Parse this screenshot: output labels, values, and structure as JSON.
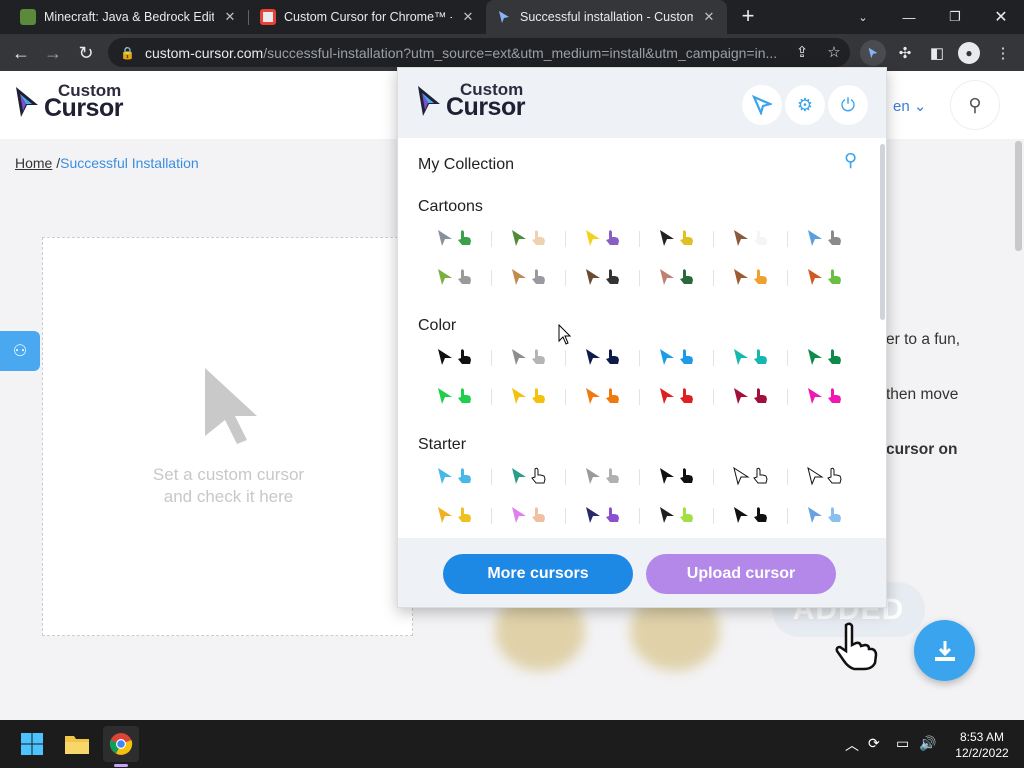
{
  "browser": {
    "tabs": [
      {
        "title": "Minecraft: Java & Bedrock Edition f",
        "active": false
      },
      {
        "title": "Custom Cursor for Chrome™ - Chr",
        "active": false
      },
      {
        "title": "Successful installation - Custom C",
        "active": true
      }
    ],
    "url_host": "custom-cursor.com",
    "url_path": "/successful-installation?utm_source=ext&utm_medium=install&utm_campaign=in..."
  },
  "site": {
    "logo_top": "Custom",
    "logo_bottom": "Cursor",
    "language": "en",
    "breadcrumb_home": "Home",
    "breadcrumb_sep": "/",
    "breadcrumb_current": "Successful Installation",
    "test_hint_line1": "Set a custom cursor",
    "test_hint_line2": "and check it here",
    "body_line1": "er to a fun,",
    "body_line2": "then move",
    "body_line3": "cursor on",
    "added_label": "ADDED"
  },
  "popup": {
    "logo_top": "Custom",
    "logo_bottom": "Cursor",
    "my_collection": "My Collection",
    "sections": [
      {
        "name": "Cartoons",
        "rows": [
          [
            [
              "#8a8f9c",
              "#3aa14a"
            ],
            [
              "#4f8c3a",
              "#f0d0b0"
            ],
            [
              "#f5d020",
              "#8a5fc4"
            ],
            [
              "#222222",
              "#e0c020"
            ],
            [
              "#8a5a3c",
              "#f5f5f5"
            ],
            [
              "#5aa0e0",
              "#8a8a8a"
            ]
          ],
          [
            [
              "#7ab040",
              "#9a9a9a"
            ],
            [
              "#c08a50",
              "#9a9aa0"
            ],
            [
              "#6a4a30",
              "#333333"
            ],
            [
              "#c08070",
              "#2a6a3a"
            ],
            [
              "#a05a30",
              "#f0a030"
            ],
            [
              "#d05a20",
              "#6abf40"
            ]
          ]
        ]
      },
      {
        "name": "Color",
        "rows": [
          [
            [
              "#111111",
              "#111111"
            ],
            [
              "#8e8e8e",
              "#b5b5b5"
            ],
            [
              "#0d1b4a",
              "#0d1b4a"
            ],
            [
              "#1e9be6",
              "#1e9be6"
            ],
            [
              "#14b8b0",
              "#14b8b0"
            ],
            [
              "#0e8a4a",
              "#0e8a4a"
            ]
          ],
          [
            [
              "#1fcf4a",
              "#1fcf4a"
            ],
            [
              "#f4c20d",
              "#f4c20d"
            ],
            [
              "#f07a10",
              "#f07a10"
            ],
            [
              "#e02020",
              "#e02020"
            ],
            [
              "#a0103a",
              "#a0103a"
            ],
            [
              "#f018b0",
              "#f018b0"
            ]
          ]
        ]
      },
      {
        "name": "Starter",
        "rows": [
          [
            [
              "#47b8e8",
              "#47b8e8"
            ],
            [
              "#2b9e8a",
              "#ffffff"
            ],
            [
              "#9a9a9a",
              "#b0b0b0"
            ],
            [
              "#111111",
              "#111111"
            ],
            [
              "#ffffff",
              "#ffffff"
            ],
            [
              "#ffffff",
              "#ffffff"
            ]
          ],
          [
            [
              "#f0b020",
              "#f0c020"
            ],
            [
              "#e080f0",
              "#f0c0a0"
            ],
            [
              "#2a2a6a",
              "#8a50d0"
            ],
            [
              "#202020",
              "#a0e040"
            ],
            [
              "#111111",
              "#111111"
            ],
            [
              "#6aa0e0",
              "#8ac0f0"
            ]
          ]
        ]
      }
    ],
    "more_button": "More cursors",
    "upload_button": "Upload cursor"
  },
  "taskbar": {
    "time": "8:53 AM",
    "date": "12/2/2022"
  },
  "colors": {
    "accent_blue": "#1e88e5",
    "accent_purple": "#b388e8",
    "site_blue": "#3aa5ee"
  }
}
